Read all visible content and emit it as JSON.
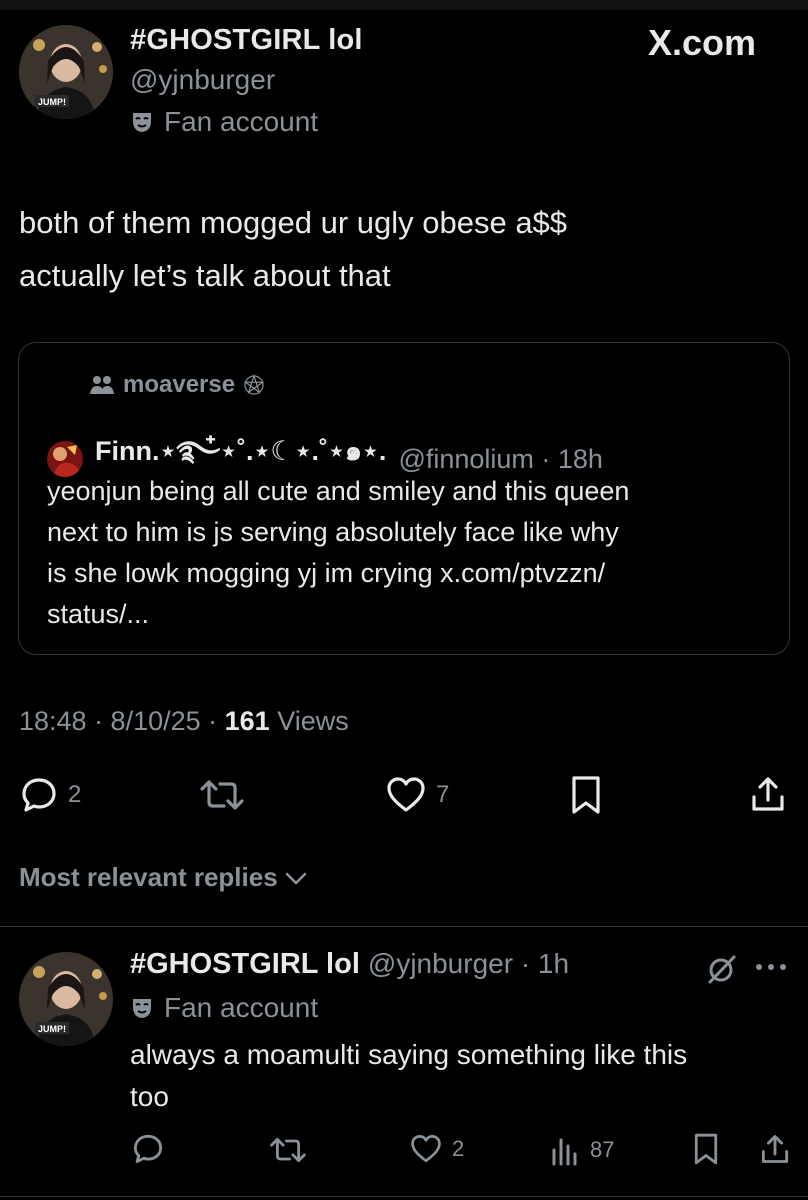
{
  "site_badge": "X.com",
  "tweet": {
    "display_name": "#GHOSTGIRL lol",
    "handle": "@yjnburger",
    "label": "Fan account",
    "text_lines": [
      "both of them mogged ur ugly obese a$$",
      "actually  let’s talk about that"
    ],
    "timestamp": "18:48 · 8/10/25 · ",
    "views_count": "161",
    "views_label": " Views",
    "actions": {
      "replies": "2",
      "reposts": "",
      "likes": "7"
    }
  },
  "quote": {
    "community": "moaverse",
    "display_name": "Finn.⋆࿐໋⋆˚.⋆☾⋆.˚⋆๑⋆.",
    "handle": "@finnolium · 18h",
    "text_lines": [
      "yeonjun being all cute and smiley and this queen",
      "next to him is js serving absolutely face like why",
      "is she lowk mogging yj im crying x.com/ptvzzn/",
      "status/..."
    ]
  },
  "replies_filter": "Most relevant replies",
  "reply": {
    "display_name": "#GHOSTGIRL lol",
    "handle": "@yjnburger · 1h",
    "label": "Fan account",
    "text_lines": [
      "always a moamulti saying something like this",
      "too"
    ],
    "actions": {
      "replies": "",
      "reposts": "",
      "likes": "2",
      "views": "87"
    }
  },
  "icons": {
    "verified_mask": "theater-mask-icon",
    "community": "people-icon",
    "reply": "speech-bubble-icon",
    "repost": "repost-icon",
    "like": "heart-icon",
    "bookmark": "bookmark-icon",
    "share": "share-icon",
    "views": "bar-chart-icon",
    "grok": "slashed-circle-icon",
    "more": "ellipsis-icon"
  },
  "colors": {
    "background": "#000000",
    "text": "#e7e9ea",
    "muted": "#8b9198",
    "border": "#333639"
  }
}
